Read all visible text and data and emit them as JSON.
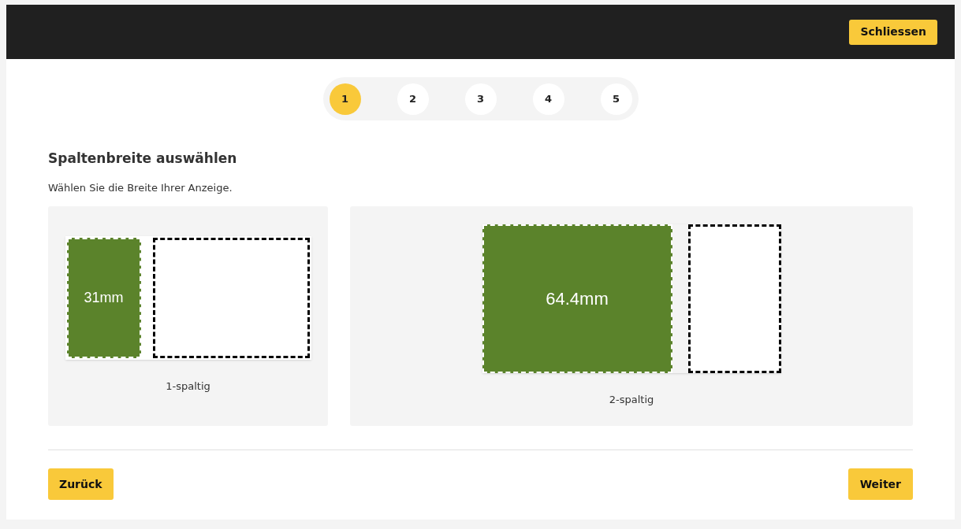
{
  "header": {
    "close_button": "Schliessen"
  },
  "steps": [
    {
      "label": "1",
      "selected": true
    },
    {
      "label": "2",
      "selected": false
    },
    {
      "label": "3",
      "selected": false
    },
    {
      "label": "4",
      "selected": false
    },
    {
      "label": "5",
      "selected": false
    }
  ],
  "title": "Spaltenbreite auswählen",
  "description": "Wählen Sie die Breite Ihrer Anzeige.",
  "options": [
    {
      "kind": "one-column",
      "width_label": "31mm",
      "label": "1-spaltig"
    },
    {
      "kind": "two-column",
      "width_label": "64.4mm",
      "label": "2-spaltig"
    }
  ],
  "footer": {
    "back_button": "Zurück",
    "next_button": "Weiter"
  }
}
